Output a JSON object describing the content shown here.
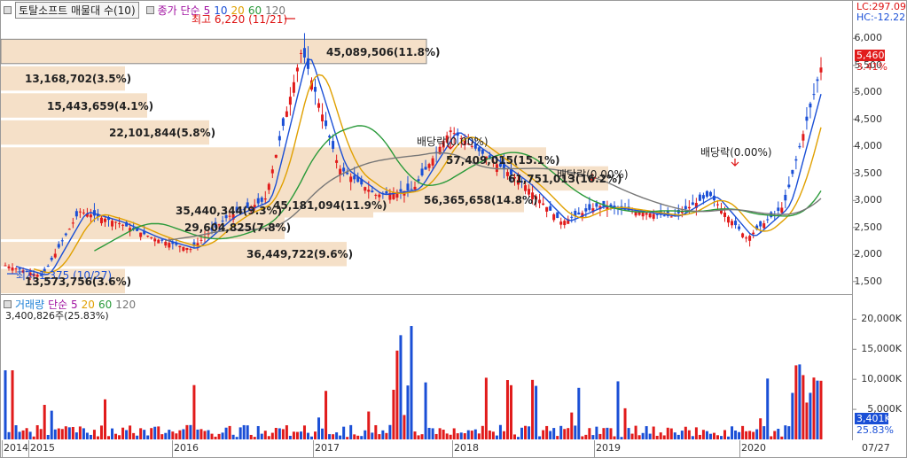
{
  "header": {
    "title": "토탈소프트 매물대 수(10)",
    "ma_legend": {
      "label": "종가 단순",
      "p5": "5",
      "p10": "10",
      "p20": "20",
      "p60": "60",
      "p120": "120"
    },
    "lc": "LC:297.09",
    "hc": "HC:-12.22"
  },
  "colors": {
    "up": "#e11b1b",
    "down": "#1a4fd6",
    "ma5": "#a010a0",
    "ma20": "#e0a000",
    "ma60": "#2a9a3a",
    "ma120": "#777777",
    "profile": "#f5e0c8"
  },
  "annotations": {
    "high": "최고 6,220 (11/21)",
    "low": "최저 1,375 (10/27)",
    "dividend1": "배당락(0.00%)",
    "dividend2": "배당락(0.00%)",
    "dividend3": "배당락(0.00%)"
  },
  "volume_profile": [
    {
      "label": "45,089,506(11.8%)",
      "price": 5750
    },
    {
      "label": "13,168,702(3.5%)",
      "price": 5250
    },
    {
      "label": "15,443,659(4.1%)",
      "price": 4750
    },
    {
      "label": "22,101,844(5.8%)",
      "price": 4250
    },
    {
      "label": "57,409,015(15.1%)",
      "price": 3750
    },
    {
      "label": "61,751,013(16.2%)",
      "price": 3400
    },
    {
      "label": "56,365,658(14.8%)",
      "price": 3000
    },
    {
      "label": "45,181,094(11.9%)",
      "price": 3000
    },
    {
      "label": "35,440,344(9.3%)",
      "price": 3000
    },
    {
      "label": "29,604,825(7.8%)",
      "price": 2500
    },
    {
      "label": "36,449,722(9.6%)",
      "price": 2000
    },
    {
      "label": "13,573,756(3.6%)",
      "price": 1500
    }
  ],
  "price_axis": {
    "ticks": [
      "6,000",
      "5,500",
      "5,000",
      "4,500",
      "4,000",
      "3,500",
      "3,000",
      "2,500",
      "2,000",
      "1,500"
    ],
    "current": "5,460",
    "change": "3.41%"
  },
  "volume": {
    "legend": {
      "label": "거래량",
      "ma": "단순 5",
      "p20": "20",
      "p60": "60",
      "p120": "120"
    },
    "info": "3,400,826주(25.83%)",
    "ticks": [
      "20,000K",
      "15,000K",
      "10,000K",
      "5,000K"
    ],
    "current": "3,401K",
    "pct": "25.83%"
  },
  "time_axis": {
    "labels": [
      "2014",
      "2015",
      "2016",
      "2017",
      "2018",
      "2019",
      "2020"
    ],
    "right": "07/27"
  },
  "chart_data": {
    "type": "candlestick",
    "title": "토탈소프트 매물대 수(10)",
    "ylim": [
      1300,
      6300
    ],
    "x": [
      "2014",
      "2015",
      "2016",
      "2017",
      "2018",
      "2019",
      "2020",
      "07/27"
    ],
    "high": {
      "value": 6220,
      "date": "11/21"
    },
    "low": {
      "value": 1375,
      "date": "10/27"
    },
    "last": 5460,
    "series": [
      {
        "name": "종가",
        "values": [
          1800,
          1600,
          2800,
          2600,
          2300,
          2100,
          2700,
          3000,
          5800,
          3600,
          3100,
          3200,
          4300,
          3800,
          3300,
          2600,
          2900,
          2800,
          2700,
          3100,
          2300,
          2900,
          5460
        ]
      }
    ]
  }
}
